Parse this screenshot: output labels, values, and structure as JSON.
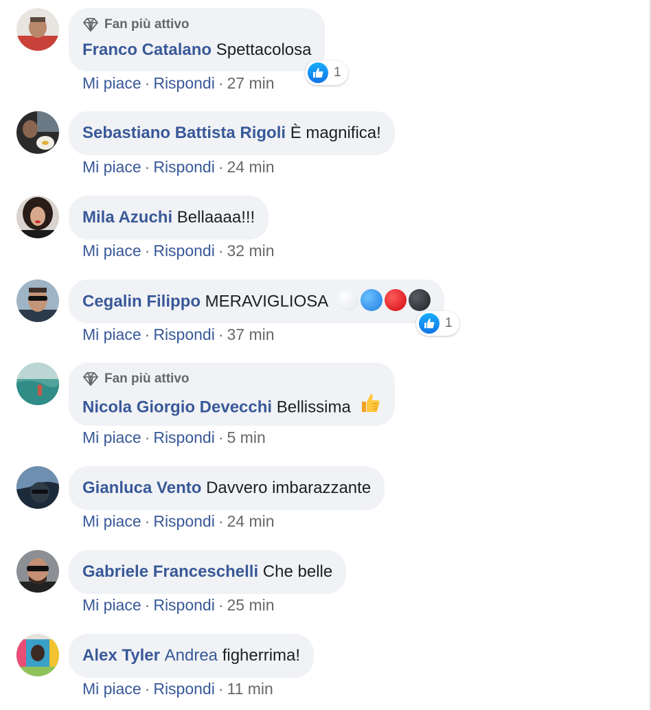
{
  "comments": [
    {
      "badge": "Fan più attivo",
      "name": "Franco Catalano",
      "name_plain": "",
      "text": "Spettacolosa",
      "like": "Mi piace",
      "reply": "Rispondi",
      "time": "27 min",
      "reactions": "1"
    },
    {
      "name": "Sebastiano Battista Rigoli",
      "name_plain": "",
      "text": "È magnifica!",
      "like": "Mi piace",
      "reply": "Rispondi",
      "time": "24 min"
    },
    {
      "name": "Mila Azuchi",
      "name_plain": "",
      "text": "Bellaaaa!!!",
      "like": "Mi piace",
      "reply": "Rispondi",
      "time": "32 min"
    },
    {
      "name": "Cegalin Filippo",
      "name_plain": "",
      "text": "MERAVIGLIOSA",
      "emoji_colors": [
        "#f4f6fa",
        "#3d9df5",
        "#e8151b",
        "#2f3137"
      ],
      "like": "Mi piace",
      "reply": "Rispondi",
      "time": "37 min",
      "reactions": "1"
    },
    {
      "badge": "Fan più attivo",
      "name": "Nicola Giorgio Devecchi",
      "name_plain": "",
      "text": "Bellissima",
      "emoji": "thumbs-up-emoji",
      "like": "Mi piace",
      "reply": "Rispondi",
      "time": "5 min"
    },
    {
      "name": "Gianluca Vento",
      "name_plain": "",
      "text": "Davvero imbarazzante",
      "like": "Mi piace",
      "reply": "Rispondi",
      "time": "24 min"
    },
    {
      "name": "Gabriele Franceschelli",
      "name_plain": "",
      "text": "Che belle",
      "like": "Mi piace",
      "reply": "Rispondi",
      "time": "25 min"
    },
    {
      "name": "Alex Tyler",
      "name_plain": "Andrea",
      "text": "figherrima!",
      "like": "Mi piace",
      "reply": "Rispondi",
      "time": "11 min"
    }
  ],
  "colors": {
    "name": "#385898",
    "bubble": "#f0f2f5",
    "meta": "#65676b",
    "like_blue": "#1877f2"
  },
  "icons": {
    "badge": "diamond-icon",
    "reaction": "like-icon",
    "sep": "·"
  }
}
